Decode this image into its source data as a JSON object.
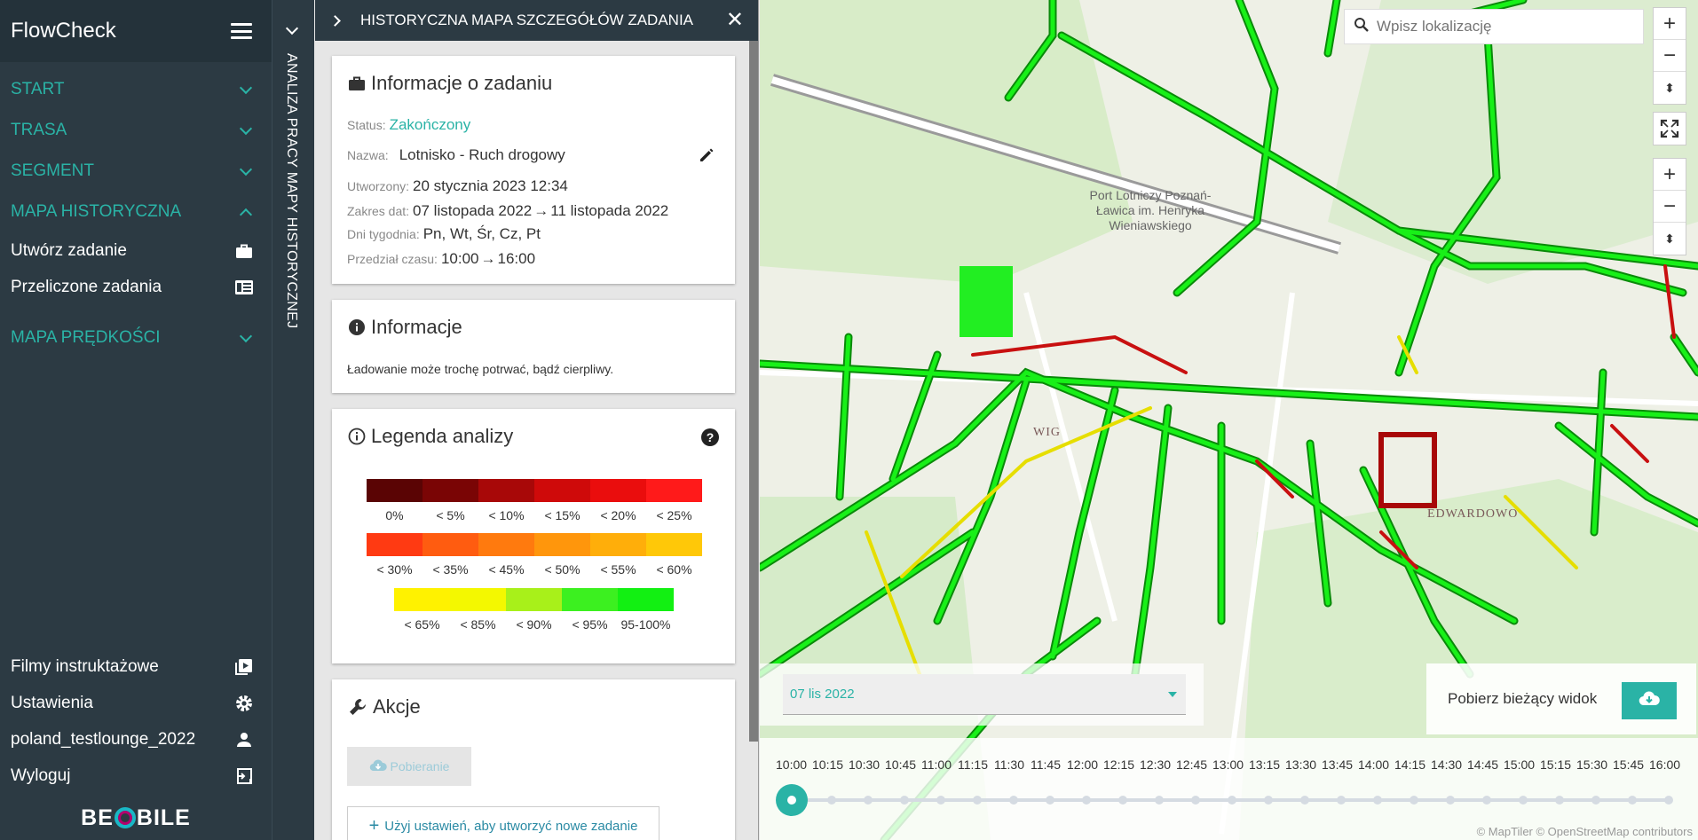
{
  "sidebar": {
    "brand": "FlowCheck",
    "menu": [
      {
        "label": "START"
      },
      {
        "label": "TRASA"
      },
      {
        "label": "SEGMENT"
      },
      {
        "label": "MAPA HISTORYCZNA"
      }
    ],
    "submenu": [
      {
        "label": "Utwórz zadanie"
      },
      {
        "label": "Przeliczone zadania"
      }
    ],
    "menu2": {
      "label": "MAPA PRĘDKOŚCI"
    },
    "bottom": [
      {
        "label": "Filmy instruktażowe"
      },
      {
        "label": "Ustawienia"
      },
      {
        "label": "poland_testlounge_2022"
      },
      {
        "label": "Wyloguj"
      }
    ],
    "logo": {
      "left": "BE",
      "right": "BILE"
    }
  },
  "vstrip": {
    "label": "ANALIZA PRACY MAPY HISTORYCZNEJ"
  },
  "panel": {
    "title": "HISTORYCZNA MAPA SZCZEGÓŁÓW ZADANIA",
    "close": "✕",
    "task": {
      "title": "Informacje o zadaniu",
      "status_label": "Status:",
      "status": "Zakończony",
      "name_label": "Nazwa:",
      "name": "Lotnisko - Ruch drogowy",
      "created_label": "Utworzony:",
      "created": "20 stycznia 2023 12:34",
      "range_label": "Zakres dat:",
      "range_from": "07 listopada 2022",
      "range_to": "11 listopada 2022",
      "days_label": "Dni tygodnia:",
      "days": "Pn, Wt, Śr, Cz, Pt",
      "time_label": "Przedział czasu:",
      "time_from": "10:00",
      "time_to": "16:00"
    },
    "info": {
      "title": "Informacje",
      "text": "Ładowanie może trochę potrwać, bądź cierpliwy."
    },
    "legend": {
      "title": "Legenda analizy",
      "help": "?",
      "row1": {
        "colors": [
          "#5a0404",
          "#7a0505",
          "#a80808",
          "#cf0a0a",
          "#ea0d0d",
          "#ff1a1a"
        ],
        "labels": [
          "0%",
          "< 5%",
          "< 10%",
          "< 15%",
          "< 20%",
          "< 25%"
        ]
      },
      "row2": {
        "colors": [
          "#ff3a12",
          "#ff5c10",
          "#ff7a0e",
          "#ff960c",
          "#ffae0a",
          "#ffc808"
        ],
        "labels": [
          "< 30%",
          "< 35%",
          "< 45%",
          "< 50%",
          "< 55%",
          "< 60%"
        ]
      },
      "row3": {
        "colors": [
          "#fff200",
          "#f4f800",
          "#a8f01a",
          "#3cf020",
          "#12f012"
        ],
        "labels": [
          "< 65%",
          "< 85%",
          "< 90%",
          "< 95%",
          "95-100%"
        ]
      }
    },
    "actions": {
      "title": "Akcje",
      "download": "Pobieranie",
      "new_task": "Użyj ustawień, aby utworzyć nowe zadanie"
    }
  },
  "map": {
    "search_placeholder": "Wpisz lokalizację",
    "place_label": "Port Lotniczy Poznań-Ławica im. Henryka Wieniawskiego",
    "district_label": "EDWARDOWO",
    "district2_label": "WIG",
    "date_select": "07 lis 2022",
    "download_view": "Pobierz bieżący widok",
    "timeline": [
      "10:00",
      "10:15",
      "10:30",
      "10:45",
      "11:00",
      "11:15",
      "11:30",
      "11:45",
      "12:00",
      "12:15",
      "12:30",
      "12:45",
      "13:00",
      "13:15",
      "13:30",
      "13:45",
      "14:00",
      "14:15",
      "14:30",
      "14:45",
      "15:00",
      "15:15",
      "15:30",
      "15:45",
      "16:00"
    ],
    "attribution": "© MapTiler © OpenStreetMap contributors",
    "colors": {
      "accent": "#2ab3a6",
      "road_good": "#11e011",
      "road_mid": "#e8e000",
      "road_bad": "#d01010"
    }
  }
}
